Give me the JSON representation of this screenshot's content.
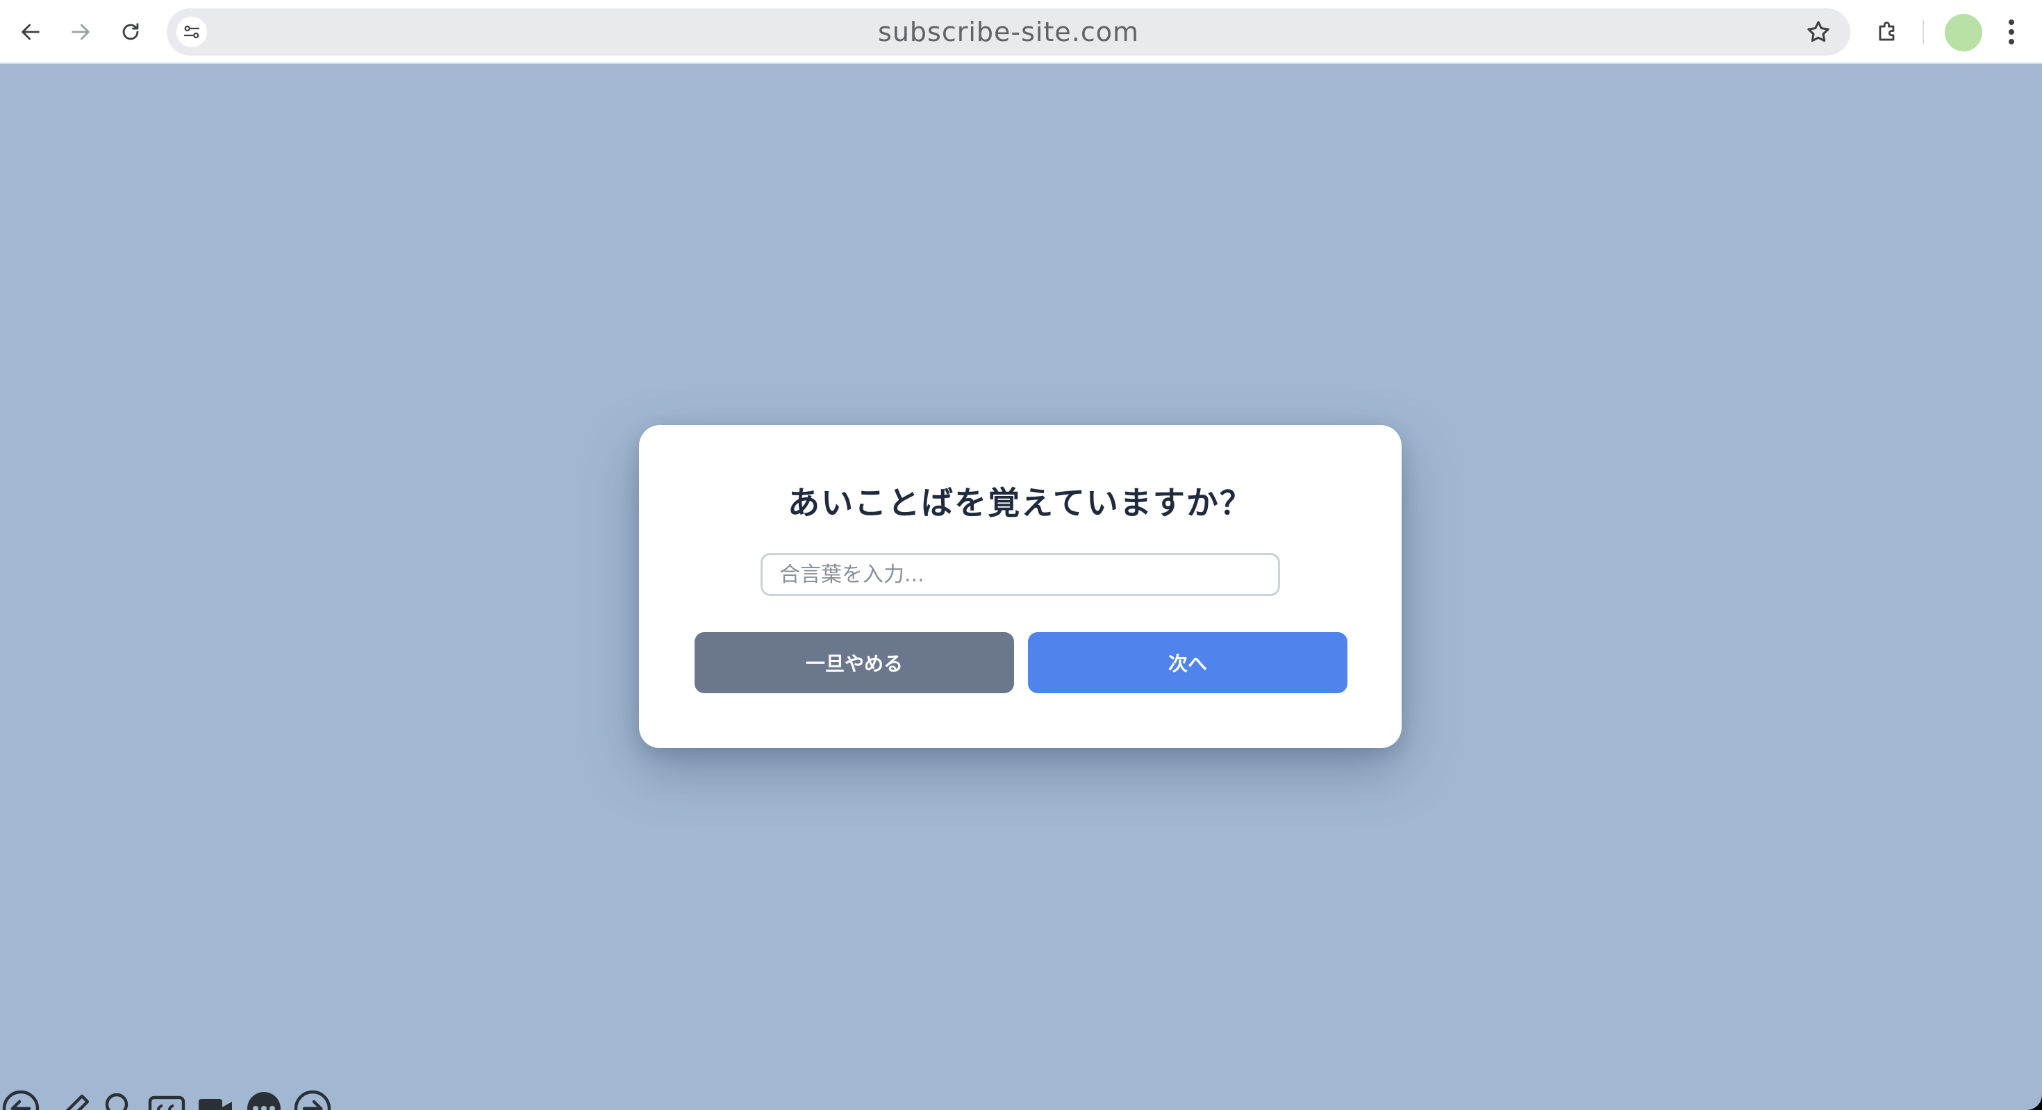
{
  "browser": {
    "url": "subscribe-site.com",
    "icons": {
      "back": "back-arrow-icon",
      "forward": "forward-arrow-icon",
      "reload": "reload-icon",
      "site_info": "site-settings-icon",
      "bookmark": "star-icon",
      "extensions": "puzzle-icon",
      "menu": "kebab-menu-icon"
    },
    "colors": {
      "avatar": "#b9e0a5"
    }
  },
  "dialog": {
    "title": "あいことばを覚えていますか？",
    "input_placeholder": "合言葉を入力...",
    "input_value": "",
    "cancel_label": "一旦やめる",
    "next_label": "次へ",
    "colors": {
      "cancel": "#6a778d",
      "next": "#4f84ec",
      "backdrop": "#a2b8d2"
    }
  },
  "bottom_toolbar": {
    "icons": [
      "back-circle-icon",
      "pencil-icon",
      "magnifier-icon",
      "captions-icon",
      "video-camera-icon",
      "more-circle-icon",
      "forward-circle-icon"
    ]
  }
}
